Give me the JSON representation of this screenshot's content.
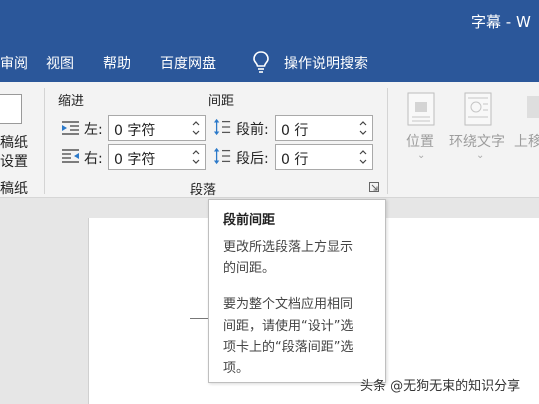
{
  "window": {
    "title": "字幕  -  W"
  },
  "menubar": {
    "tabs": [
      "审阅",
      "视图",
      "帮助",
      "百度网盘"
    ],
    "search_label": "操作说明搜索"
  },
  "ribbon": {
    "left_group": {
      "button_line1": "稿纸",
      "button_line2": "设置",
      "group_label": "稿纸"
    },
    "paragraph": {
      "indent_heading": "缩进",
      "spacing_heading": "间距",
      "indent_left_label": "左:",
      "indent_left_value": "0 字符",
      "indent_right_label": "右:",
      "indent_right_value": "0 字符",
      "spacing_before_label": "段前:",
      "spacing_before_value": "0 行",
      "spacing_after_label": "段后:",
      "spacing_after_value": "0 行",
      "group_label": "段落"
    },
    "arrange": {
      "position_label": "位置",
      "wrap_label": "环绕文字",
      "forward_label": "上移"
    }
  },
  "tooltip": {
    "title": "段前间距",
    "lines": [
      "更改所选段落上方显示",
      "的间距。",
      "",
      "要为整个文档应用相同",
      "间距，请使用“设计”选",
      "项卡上的“段落间距”选",
      "项。"
    ]
  },
  "watermark": "头条 @无狗无束的知识分享",
  "colors": {
    "titlebar": "#2b579a",
    "ribbon": "#f3f3f3"
  }
}
